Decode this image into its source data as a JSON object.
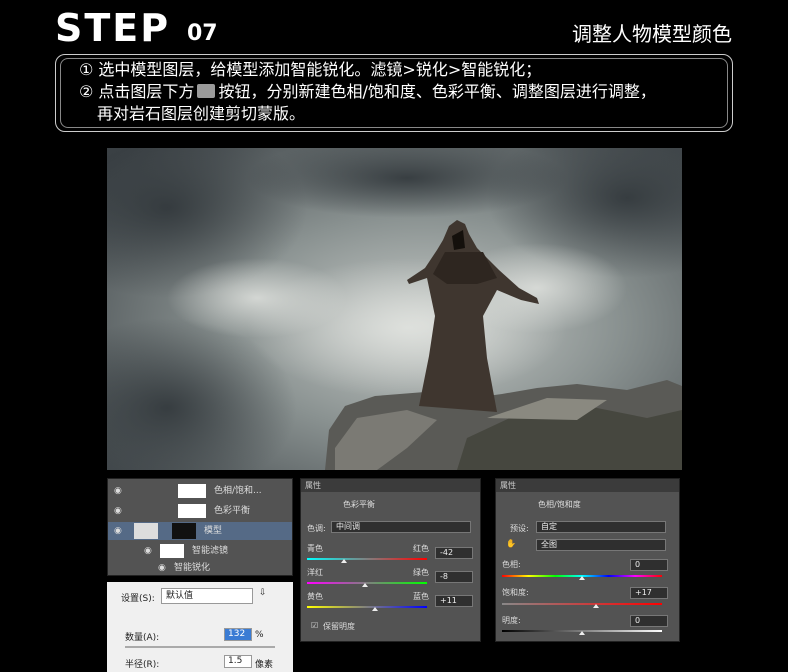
{
  "header": {
    "step": "STEP",
    "step_num": "07",
    "title": "调整人物模型颜色"
  },
  "instructions": {
    "line1": "① 选中模型图层，给模型添加智能锐化。滤镜>锐化>智能锐化；",
    "line2a": "② 点击图层下方",
    "line2b": "按钮，分别新建色相/饱和度、色彩平衡、调整图层进行调整，",
    "line3": "再对岩石图层创建剪切蒙版。"
  },
  "layers": {
    "items": [
      {
        "name": "色相/饱和...",
        "icon": "eye-icon"
      },
      {
        "name": "色彩平衡",
        "icon": "eye-icon"
      },
      {
        "name": "模型",
        "icon": "eye-icon"
      },
      {
        "name": "智能滤镜",
        "icon": "eye-icon"
      },
      {
        "name": "智能锐化",
        "icon": "eye-icon"
      }
    ]
  },
  "color_balance": {
    "tab": "属性",
    "title": "色彩平衡",
    "tone_label": "色调:",
    "tone_value": "中间调",
    "cyan": "青色",
    "red": "红色",
    "cyan_value": "-42",
    "magenta": "洋红",
    "green": "绿色",
    "magenta_value": "-8",
    "yellow": "黄色",
    "blue": "蓝色",
    "yellow_value": "+11",
    "preserve": "保留明度"
  },
  "hue_sat": {
    "tab": "属性",
    "title": "色相/饱和度",
    "preset_label": "预设:",
    "preset_value": "自定",
    "channel_value": "全图",
    "hue_label": "色相:",
    "hue_value": "0",
    "sat_label": "饱和度:",
    "sat_value": "+17",
    "light_label": "明度:",
    "light_value": "0"
  },
  "sharpen": {
    "settings_label": "设置(S):",
    "settings_value": "默认值",
    "amount_label": "数量(A):",
    "amount_value": "132",
    "amount_unit": "%",
    "radius_label": "半径(R):",
    "radius_value": "1.5",
    "radius_unit": "像素"
  }
}
